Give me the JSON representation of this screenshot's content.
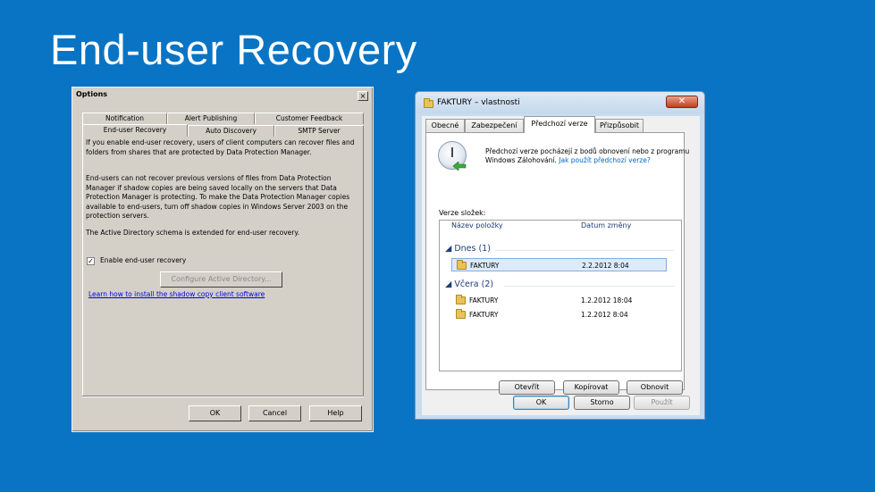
{
  "slide": {
    "title": "End-user Recovery"
  },
  "options_dialog": {
    "title": "Options",
    "close_glyph": "×",
    "tabs": [
      {
        "label": "Notification"
      },
      {
        "label": "Alert Publishing"
      },
      {
        "label": "Customer Feedback"
      },
      {
        "label": "End-user Recovery"
      },
      {
        "label": "Auto Discovery"
      },
      {
        "label": "SMTP Server"
      }
    ],
    "active_tab": "End-user Recovery",
    "paragraph_1": "If you enable end-user recovery, users of client computers can recover files and folders from shares that are protected by Data Protection Manager.",
    "paragraph_2": "End-users can not recover previous versions of files from Data Protection Manager if shadow copies are being saved locally on the servers that Data Protection Manager is protecting. To make the Data Protection Manager copies available to end-users, turn off shadow copies in Windows Server 2003 on the protection servers.",
    "paragraph_3": "The Active Directory schema is extended for end-user recovery.",
    "checkbox_label": "Enable end-user recovery",
    "checkbox_checked": true,
    "checkbox_mark": "✓",
    "configure_button": "Configure Active Directory...",
    "link_text": "Learn how to install the shadow copy client software",
    "ok_button": "OK",
    "cancel_button": "Cancel",
    "help_button": "Help"
  },
  "properties_dialog": {
    "title": "FAKTURY – vlastnosti",
    "close_glyph": "✕",
    "tabs": [
      {
        "label": "Obecné"
      },
      {
        "label": "Zabezpečení"
      },
      {
        "label": "Předchozí verze"
      },
      {
        "label": "Přizpůsobit"
      }
    ],
    "active_tab": "Předchozí verze",
    "description": "Předchozí verze pocházejí z bodů obnovení nebo z programu Windows Zálohování.",
    "description_link": "Jak použít předchozí verze?",
    "list_label": "Verze složek:",
    "columns": {
      "name": "Název položky",
      "date": "Datum změny"
    },
    "groups": [
      {
        "label": "Dnes (1)",
        "items": [
          {
            "name": "FAKTURY",
            "date": "2.2.2012 8:04",
            "selected": true
          }
        ]
      },
      {
        "label": "Včera (2)",
        "items": [
          {
            "name": "FAKTURY",
            "date": "1.2.2012 18:04",
            "selected": false
          },
          {
            "name": "FAKTURY",
            "date": "1.2.2012 8:04",
            "selected": false
          }
        ]
      }
    ],
    "open_button": "Otevřít",
    "copy_button": "Kopírovat",
    "restore_button": "Obnovit",
    "ok_button": "OK",
    "cancel_button": "Storno",
    "apply_button": "Použít"
  }
}
